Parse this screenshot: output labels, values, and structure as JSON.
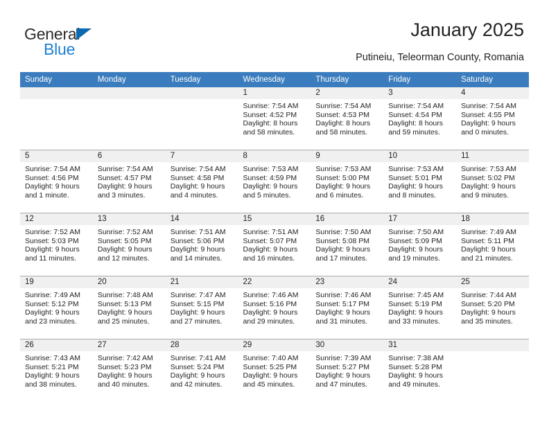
{
  "brand": {
    "name_part1": "General",
    "name_part2": "Blue",
    "accent_color": "#1b7fd4",
    "triangle_color": "#0c69b0"
  },
  "header": {
    "title": "January 2025",
    "subtitle": "Putineiu, Teleorman County, Romania"
  },
  "calendar": {
    "header_bg": "#3a7cbd",
    "daynum_bg": "#f0f0f0",
    "weekday_headers": [
      "Sunday",
      "Monday",
      "Tuesday",
      "Wednesday",
      "Thursday",
      "Friday",
      "Saturday"
    ],
    "labels": {
      "sunrise": "Sunrise:",
      "sunset": "Sunset:",
      "daylight": "Daylight:"
    },
    "weeks": [
      [
        {
          "day": "",
          "empty": true
        },
        {
          "day": "",
          "empty": true
        },
        {
          "day": "",
          "empty": true
        },
        {
          "day": "1",
          "sunrise": "Sunrise: 7:54 AM",
          "sunset": "Sunset: 4:52 PM",
          "daylight": "Daylight: 8 hours and 58 minutes."
        },
        {
          "day": "2",
          "sunrise": "Sunrise: 7:54 AM",
          "sunset": "Sunset: 4:53 PM",
          "daylight": "Daylight: 8 hours and 58 minutes."
        },
        {
          "day": "3",
          "sunrise": "Sunrise: 7:54 AM",
          "sunset": "Sunset: 4:54 PM",
          "daylight": "Daylight: 8 hours and 59 minutes."
        },
        {
          "day": "4",
          "sunrise": "Sunrise: 7:54 AM",
          "sunset": "Sunset: 4:55 PM",
          "daylight": "Daylight: 9 hours and 0 minutes."
        }
      ],
      [
        {
          "day": "5",
          "sunrise": "Sunrise: 7:54 AM",
          "sunset": "Sunset: 4:56 PM",
          "daylight": "Daylight: 9 hours and 1 minute."
        },
        {
          "day": "6",
          "sunrise": "Sunrise: 7:54 AM",
          "sunset": "Sunset: 4:57 PM",
          "daylight": "Daylight: 9 hours and 3 minutes."
        },
        {
          "day": "7",
          "sunrise": "Sunrise: 7:54 AM",
          "sunset": "Sunset: 4:58 PM",
          "daylight": "Daylight: 9 hours and 4 minutes."
        },
        {
          "day": "8",
          "sunrise": "Sunrise: 7:53 AM",
          "sunset": "Sunset: 4:59 PM",
          "daylight": "Daylight: 9 hours and 5 minutes."
        },
        {
          "day": "9",
          "sunrise": "Sunrise: 7:53 AM",
          "sunset": "Sunset: 5:00 PM",
          "daylight": "Daylight: 9 hours and 6 minutes."
        },
        {
          "day": "10",
          "sunrise": "Sunrise: 7:53 AM",
          "sunset": "Sunset: 5:01 PM",
          "daylight": "Daylight: 9 hours and 8 minutes."
        },
        {
          "day": "11",
          "sunrise": "Sunrise: 7:53 AM",
          "sunset": "Sunset: 5:02 PM",
          "daylight": "Daylight: 9 hours and 9 minutes."
        }
      ],
      [
        {
          "day": "12",
          "sunrise": "Sunrise: 7:52 AM",
          "sunset": "Sunset: 5:03 PM",
          "daylight": "Daylight: 9 hours and 11 minutes."
        },
        {
          "day": "13",
          "sunrise": "Sunrise: 7:52 AM",
          "sunset": "Sunset: 5:05 PM",
          "daylight": "Daylight: 9 hours and 12 minutes."
        },
        {
          "day": "14",
          "sunrise": "Sunrise: 7:51 AM",
          "sunset": "Sunset: 5:06 PM",
          "daylight": "Daylight: 9 hours and 14 minutes."
        },
        {
          "day": "15",
          "sunrise": "Sunrise: 7:51 AM",
          "sunset": "Sunset: 5:07 PM",
          "daylight": "Daylight: 9 hours and 16 minutes."
        },
        {
          "day": "16",
          "sunrise": "Sunrise: 7:50 AM",
          "sunset": "Sunset: 5:08 PM",
          "daylight": "Daylight: 9 hours and 17 minutes."
        },
        {
          "day": "17",
          "sunrise": "Sunrise: 7:50 AM",
          "sunset": "Sunset: 5:09 PM",
          "daylight": "Daylight: 9 hours and 19 minutes."
        },
        {
          "day": "18",
          "sunrise": "Sunrise: 7:49 AM",
          "sunset": "Sunset: 5:11 PM",
          "daylight": "Daylight: 9 hours and 21 minutes."
        }
      ],
      [
        {
          "day": "19",
          "sunrise": "Sunrise: 7:49 AM",
          "sunset": "Sunset: 5:12 PM",
          "daylight": "Daylight: 9 hours and 23 minutes."
        },
        {
          "day": "20",
          "sunrise": "Sunrise: 7:48 AM",
          "sunset": "Sunset: 5:13 PM",
          "daylight": "Daylight: 9 hours and 25 minutes."
        },
        {
          "day": "21",
          "sunrise": "Sunrise: 7:47 AM",
          "sunset": "Sunset: 5:15 PM",
          "daylight": "Daylight: 9 hours and 27 minutes."
        },
        {
          "day": "22",
          "sunrise": "Sunrise: 7:46 AM",
          "sunset": "Sunset: 5:16 PM",
          "daylight": "Daylight: 9 hours and 29 minutes."
        },
        {
          "day": "23",
          "sunrise": "Sunrise: 7:46 AM",
          "sunset": "Sunset: 5:17 PM",
          "daylight": "Daylight: 9 hours and 31 minutes."
        },
        {
          "day": "24",
          "sunrise": "Sunrise: 7:45 AM",
          "sunset": "Sunset: 5:19 PM",
          "daylight": "Daylight: 9 hours and 33 minutes."
        },
        {
          "day": "25",
          "sunrise": "Sunrise: 7:44 AM",
          "sunset": "Sunset: 5:20 PM",
          "daylight": "Daylight: 9 hours and 35 minutes."
        }
      ],
      [
        {
          "day": "26",
          "sunrise": "Sunrise: 7:43 AM",
          "sunset": "Sunset: 5:21 PM",
          "daylight": "Daylight: 9 hours and 38 minutes."
        },
        {
          "day": "27",
          "sunrise": "Sunrise: 7:42 AM",
          "sunset": "Sunset: 5:23 PM",
          "daylight": "Daylight: 9 hours and 40 minutes."
        },
        {
          "day": "28",
          "sunrise": "Sunrise: 7:41 AM",
          "sunset": "Sunset: 5:24 PM",
          "daylight": "Daylight: 9 hours and 42 minutes."
        },
        {
          "day": "29",
          "sunrise": "Sunrise: 7:40 AM",
          "sunset": "Sunset: 5:25 PM",
          "daylight": "Daylight: 9 hours and 45 minutes."
        },
        {
          "day": "30",
          "sunrise": "Sunrise: 7:39 AM",
          "sunset": "Sunset: 5:27 PM",
          "daylight": "Daylight: 9 hours and 47 minutes."
        },
        {
          "day": "31",
          "sunrise": "Sunrise: 7:38 AM",
          "sunset": "Sunset: 5:28 PM",
          "daylight": "Daylight: 9 hours and 49 minutes."
        },
        {
          "day": "",
          "empty": true
        }
      ]
    ]
  }
}
